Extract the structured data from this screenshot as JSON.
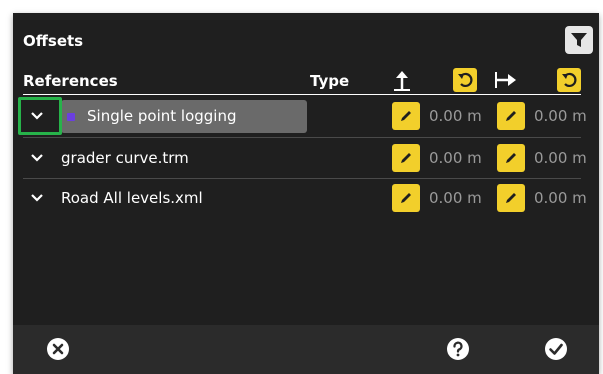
{
  "dialog": {
    "title": "Offsets",
    "filter_icon": "filter-icon"
  },
  "header": {
    "references": "References",
    "type": "Type",
    "vertical_icon": "arrow-up-icon",
    "vertical_undo_icon": "undo-icon",
    "horizontal_icon": "arrow-right-icon",
    "horizontal_undo_icon": "undo-icon"
  },
  "rows": [
    {
      "label": "Single point logging",
      "vertical": "0.00 m",
      "horizontal": "0.00 m",
      "selected": true,
      "marker_color": "#6b3fe0"
    },
    {
      "label": "grader curve.trm",
      "vertical": "0.00 m",
      "horizontal": "0.00 m",
      "selected": false
    },
    {
      "label": "Road All levels.xml",
      "vertical": "0.00 m",
      "horizontal": "0.00 m",
      "selected": false
    }
  ],
  "footer": {
    "cancel_icon": "cancel-icon",
    "help_icon": "help-icon",
    "accept_icon": "accept-icon"
  },
  "colors": {
    "accent": "#f2cf2b",
    "highlight": "#27b34a",
    "background": "#1f1f1f"
  }
}
